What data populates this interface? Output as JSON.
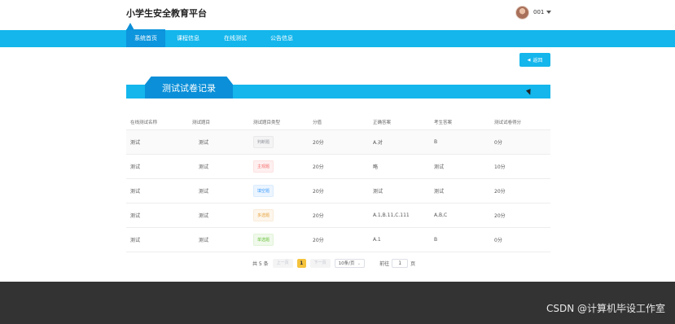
{
  "header": {
    "site_title": "小学生安全教育平台",
    "username": "001"
  },
  "nav": {
    "active": "系统首页",
    "items": [
      "课程信息",
      "在线测试",
      "公告信息"
    ]
  },
  "back_button": {
    "label": "返回",
    "icon": "arrow-left-icon"
  },
  "section": {
    "title": "测试试卷记录"
  },
  "table": {
    "columns": [
      "在线测试名称",
      "测试题目",
      "测试题目类型",
      "分值",
      "正确答案",
      "考生答案",
      "测试试卷得分"
    ],
    "rows": [
      {
        "name": "测试",
        "question": "测试",
        "type": "判断题",
        "type_color": "grey",
        "score": "20分",
        "answer": "A.对",
        "student": "B",
        "result": "0分"
      },
      {
        "name": "测试",
        "question": "测试",
        "type": "主观题",
        "type_color": "red",
        "score": "20分",
        "answer": "略",
        "student": "测试",
        "result": "10分"
      },
      {
        "name": "测试",
        "question": "测试",
        "type": "填空题",
        "type_color": "blue",
        "score": "20分",
        "answer": "测试",
        "student": "测试",
        "result": "20分"
      },
      {
        "name": "测试",
        "question": "测试",
        "type": "多选题",
        "type_color": "orange",
        "score": "20分",
        "answer": "A.1,B.11,C.111",
        "student": "A,B,C",
        "result": "20分"
      },
      {
        "name": "测试",
        "question": "测试",
        "type": "单选题",
        "type_color": "green",
        "score": "20分",
        "answer": "A.1",
        "student": "B",
        "result": "0分"
      }
    ]
  },
  "pagination": {
    "total": "共 5 条",
    "prev": "上一页",
    "current": "1",
    "next": "下一页",
    "size": "10条/页",
    "goto_label": "前往",
    "goto_value": "1",
    "goto_suffix": "页"
  },
  "watermark": "CSDN @计算机毕设工作室"
}
